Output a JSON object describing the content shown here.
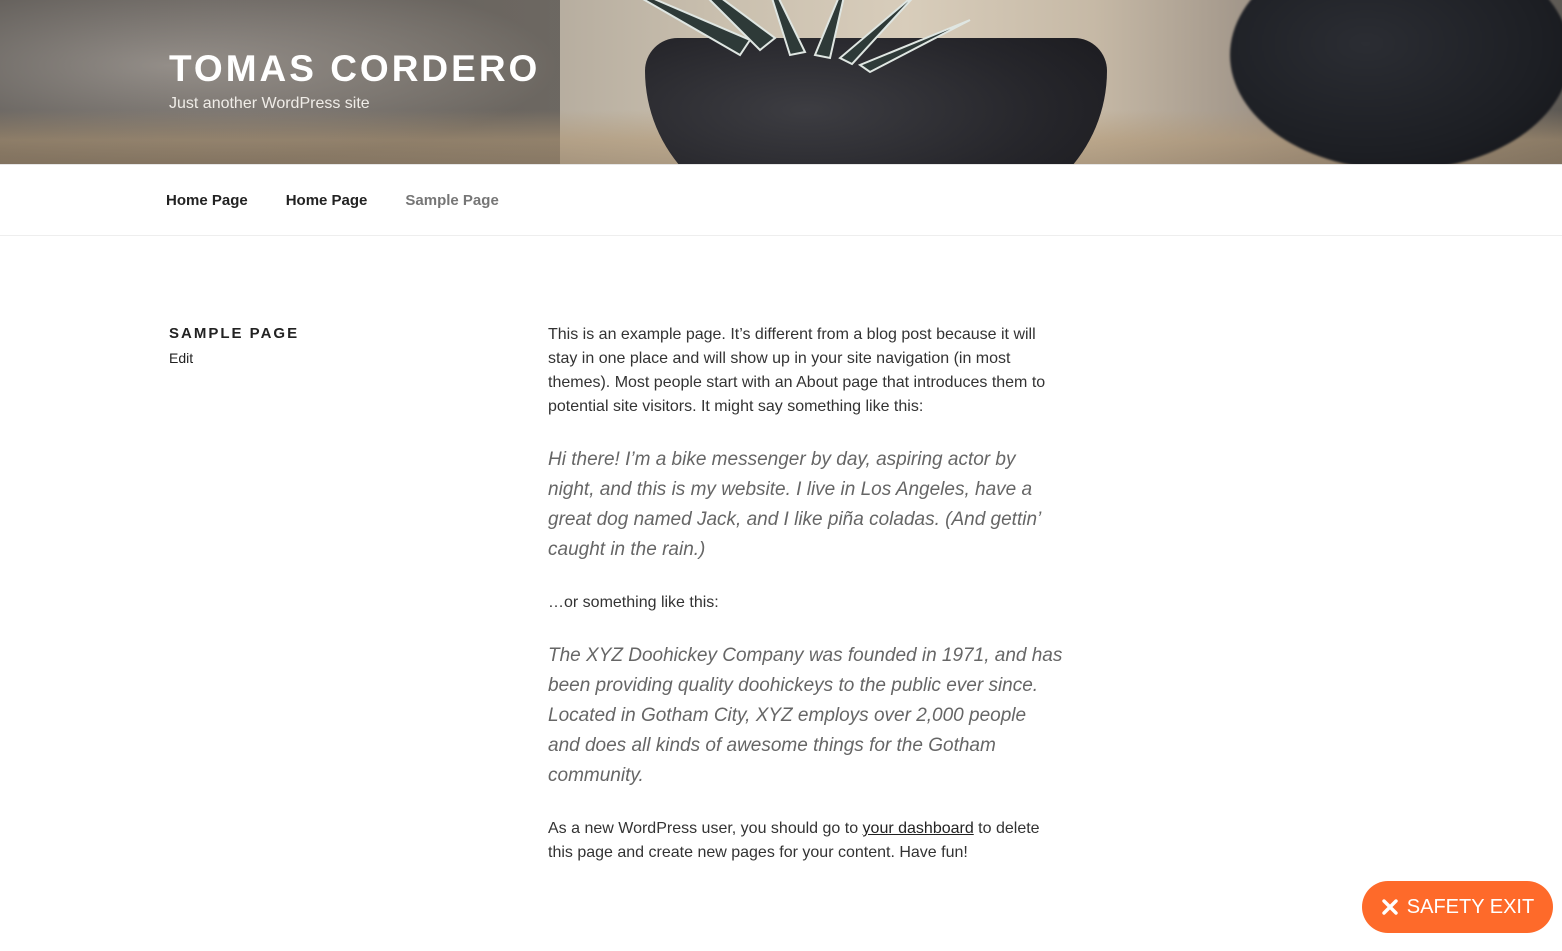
{
  "site": {
    "title": "TOMAS CORDERO",
    "description": "Just another WordPress site"
  },
  "nav": {
    "items": [
      {
        "label": "Home Page"
      },
      {
        "label": "Home Page"
      },
      {
        "label": "Sample Page"
      }
    ]
  },
  "page": {
    "title": "SAMPLE PAGE",
    "edit_label": "Edit"
  },
  "content": {
    "paragraph_1": "This is an example page. It’s different from a blog post because it will stay in one place and will show up in your site navigation (in most themes). Most people start with an About page that introduces them to potential site visitors. It might say something like this:",
    "quote_1": "Hi there! I’m a bike messenger by day, aspiring actor by night, and this is my website. I live in Los Angeles, have a great dog named Jack, and I like piña coladas. (And gettin’ caught in the rain.)",
    "paragraph_2": "…or something like this:",
    "quote_2": "The XYZ Doohickey Company was founded in 1971, and has been providing quality doohickeys to the public ever since. Located in Gotham City, XYZ employs over 2,000 people and does all kinds of awesome things for the Gotham community.",
    "paragraph_3_before": "As a new WordPress user, you should go to ",
    "paragraph_3_link": "your dashboard",
    "paragraph_3_after": " to delete this page and create new pages for your content. Have fun!"
  },
  "safety_exit": {
    "label": "SAFETY EXIT",
    "icon": "close-icon",
    "color": "#fe6a2a"
  }
}
